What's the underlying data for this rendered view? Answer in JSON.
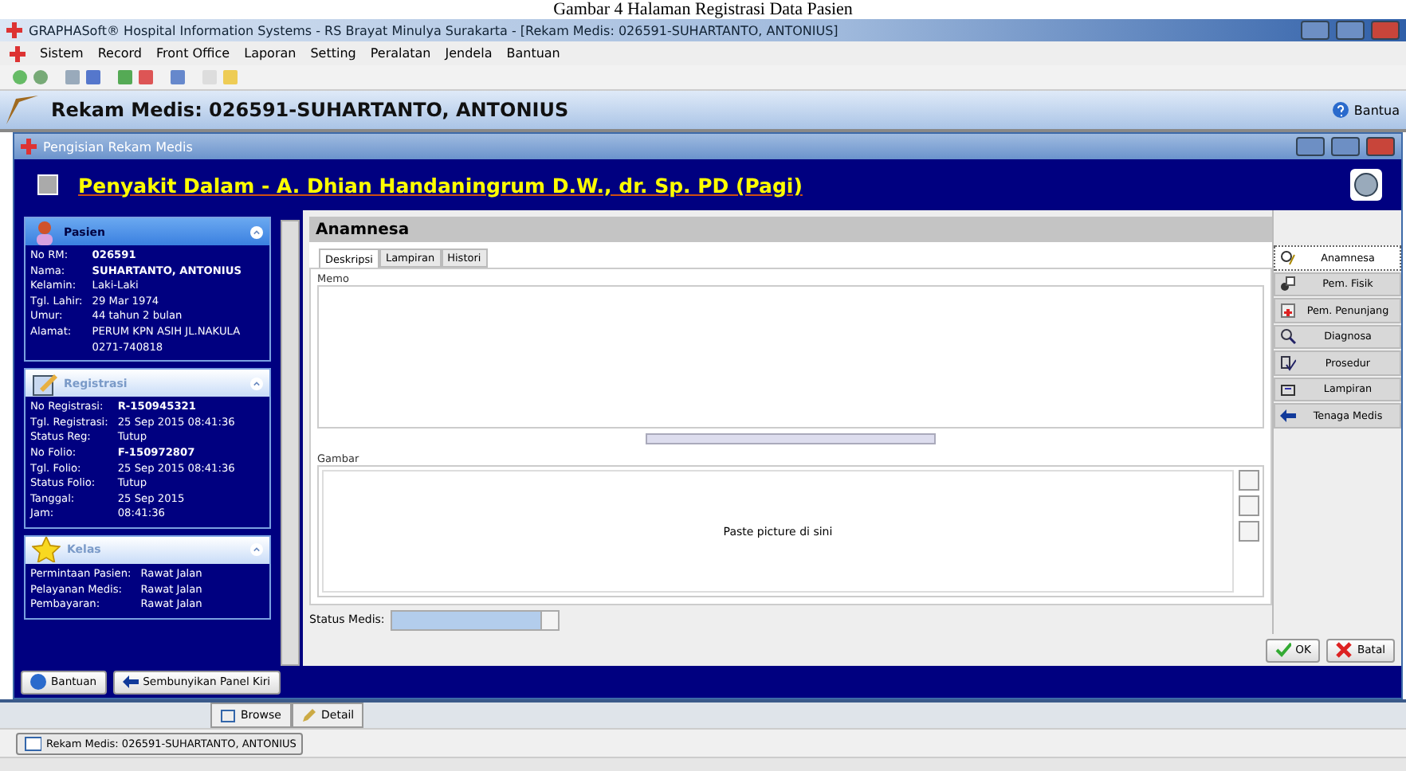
{
  "caption": "Gambar 4 Halaman Registrasi Data Pasien",
  "window": {
    "title": "GRAPHASoft® Hospital Information Systems - RS Brayat Minulya Surakarta - [Rekam Medis: 026591-SUHARTANTO, ANTONIUS]",
    "menu": [
      "Sistem",
      "Record",
      "Front Office",
      "Laporan",
      "Setting",
      "Peralatan",
      "Jendela",
      "Bantuan"
    ]
  },
  "module_header": {
    "title": "Rekam Medis: 026591-SUHARTANTO, ANTONIUS",
    "help_button": "Bantua"
  },
  "child_window": {
    "title": "Pengisian Rekam Medis"
  },
  "doctor_banner": "Penyakit Dalam - A. Dhian Handaningrum D.W., dr. Sp. PD (Pagi)",
  "left_panel": {
    "sections": [
      {
        "kind": "patient",
        "title": "Pasien",
        "fields": [
          {
            "label": "No RM:",
            "value": "026591",
            "bold": true
          },
          {
            "label": "Nama:",
            "value": "SUHARTANTO, ANTONIUS",
            "bold": true
          },
          {
            "label": "Kelamin:",
            "value": "Laki-Laki",
            "bold": false
          },
          {
            "label": "Tgl. Lahir:",
            "value": "29 Mar 1974",
            "bold": false
          },
          {
            "label": "Umur:",
            "value": "44 tahun 2 bulan",
            "bold": false
          },
          {
            "label": "Alamat:",
            "value": "PERUM KPN ASIH JL.NAKULA 0271-740818",
            "bold": false
          }
        ]
      },
      {
        "kind": "registration",
        "title": "Registrasi",
        "fields": [
          {
            "label": "No Registrasi:",
            "value": "R-150945321",
            "bold": true
          },
          {
            "label": "Tgl. Registrasi:",
            "value": "25 Sep 2015  08:41:36",
            "bold": false
          },
          {
            "label": "Status Reg:",
            "value": "Tutup",
            "bold": false
          },
          {
            "label": "No Folio:",
            "value": "F-150972807",
            "bold": true
          },
          {
            "label": "Tgl. Folio:",
            "value": "25 Sep 2015  08:41:36",
            "bold": false
          },
          {
            "label": "Status Folio:",
            "value": "Tutup",
            "bold": false
          },
          {
            "label": "Tanggal:",
            "value": "25 Sep 2015",
            "bold": false
          },
          {
            "label": "Jam:",
            "value": "08:41:36",
            "bold": false
          }
        ]
      },
      {
        "kind": "class",
        "title": "Kelas",
        "fields": [
          {
            "label": "Permintaan Pasien:",
            "value": "Rawat Jalan",
            "bold": false
          },
          {
            "label": "Pelayanan Medis:",
            "value": "Rawat Jalan",
            "bold": false
          },
          {
            "label": "Pembayaran:",
            "value": "Rawat Jalan",
            "bold": false
          }
        ]
      }
    ],
    "buttons": [
      "Bantuan",
      "Sembunyikan Panel Kiri"
    ]
  },
  "content": {
    "title": "Anamnesa",
    "tabs": [
      {
        "label": "Deskripsi",
        "selected": true
      },
      {
        "label": "Lampiran",
        "selected": false
      },
      {
        "label": "Histori",
        "selected": false
      }
    ],
    "memo_label": "Memo",
    "picture_label": "Gambar",
    "picture_hint": "Paste picture di sini",
    "status_label": "Status Medis:"
  },
  "side_nav": [
    {
      "kind": "search",
      "label": "Anamnesa",
      "selected": true
    },
    {
      "kind": "exam",
      "label": "Pem. Fisik",
      "selected": false
    },
    {
      "kind": "lab",
      "label": "Pem. Penunjang",
      "selected": false
    },
    {
      "kind": "magnifier",
      "label": "Diagnosa",
      "selected": false
    },
    {
      "kind": "check",
      "label": "Prosedur",
      "selected": false
    },
    {
      "kind": "attach",
      "label": "Lampiran",
      "selected": false
    },
    {
      "kind": "arrow",
      "label": "Tenaga Medis",
      "selected": false
    }
  ],
  "actions": [
    {
      "kind": "ok",
      "label": "OK"
    },
    {
      "kind": "cancel",
      "label": "Batal"
    }
  ],
  "bottom_tabs": [
    "Browse",
    "Detail"
  ],
  "taskbar_item": "Rekam Medis: 026591-SUHARTANTO, ANTONIUS"
}
